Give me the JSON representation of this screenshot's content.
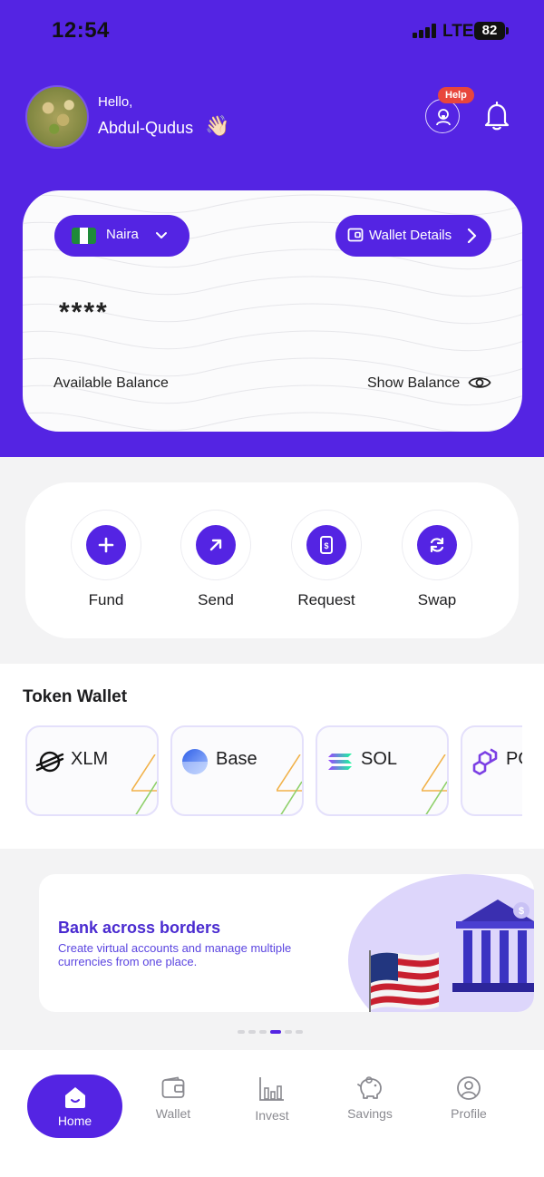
{
  "status_bar": {
    "time": "12:54",
    "network": "LTE",
    "battery": "82"
  },
  "header": {
    "greeting": "Hello,",
    "user_name": "Abdul-Qudus",
    "wave_emoji": "👋🏻",
    "help_badge": "Help"
  },
  "balance_card": {
    "currency": "Naira",
    "wallet_details_label": "Wallet Details",
    "masked_balance": "****",
    "available_label": "Available Balance",
    "show_balance_label": "Show Balance"
  },
  "actions": [
    {
      "label": "Fund",
      "icon": "plus-icon"
    },
    {
      "label": "Send",
      "icon": "arrow-up-right-icon"
    },
    {
      "label": "Request",
      "icon": "request-money-icon"
    },
    {
      "label": "Swap",
      "icon": "swap-icon"
    }
  ],
  "token_wallet": {
    "title": "Token Wallet",
    "tokens": [
      {
        "name": "XLM",
        "icon": "stellar-icon"
      },
      {
        "name": "Base",
        "icon": "base-icon"
      },
      {
        "name": "SOL",
        "icon": "solana-icon"
      },
      {
        "name": "PO",
        "icon": "polygon-icon"
      }
    ]
  },
  "promo": {
    "title": "Bank across borders",
    "subtitle": "Create virtual accounts and manage multiple currencies from one place.",
    "active_dot": 3,
    "dot_count": 6
  },
  "bottom_nav": [
    {
      "label": "Home",
      "icon": "home-icon",
      "active": true
    },
    {
      "label": "Wallet",
      "icon": "wallet-icon"
    },
    {
      "label": "Invest",
      "icon": "bar-chart-icon"
    },
    {
      "label": "Savings",
      "icon": "piggy-bank-icon"
    },
    {
      "label": "Profile",
      "icon": "profile-icon"
    }
  ],
  "colors": {
    "brand": "#5424e3",
    "badge": "#e8463c"
  }
}
